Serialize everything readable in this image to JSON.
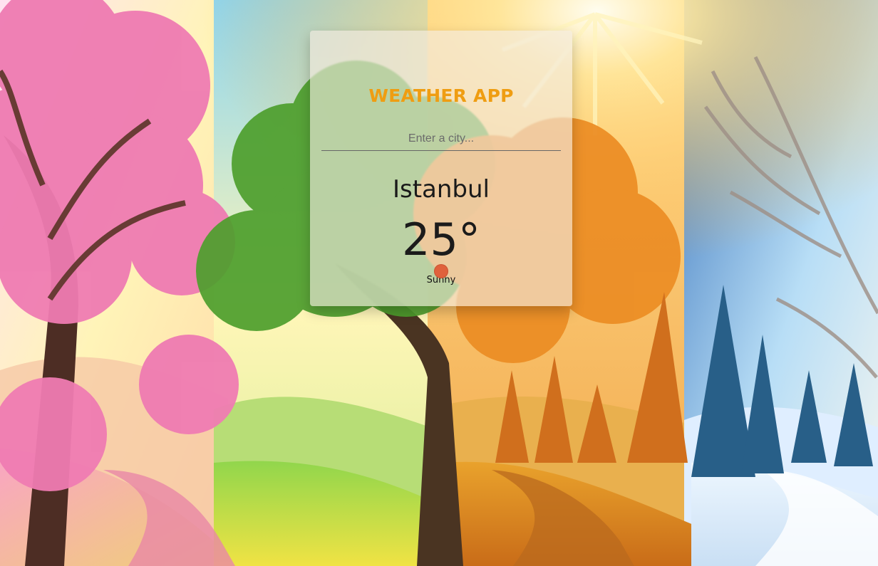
{
  "app": {
    "title": "WEATHER APP"
  },
  "search": {
    "placeholder": "Enter a city..."
  },
  "weather": {
    "city": "Istanbul",
    "temperature": "25°",
    "condition": "Sunny",
    "icon": "sun-icon"
  },
  "colors": {
    "accent": "#ef9d12",
    "icon": "#e0613c"
  }
}
